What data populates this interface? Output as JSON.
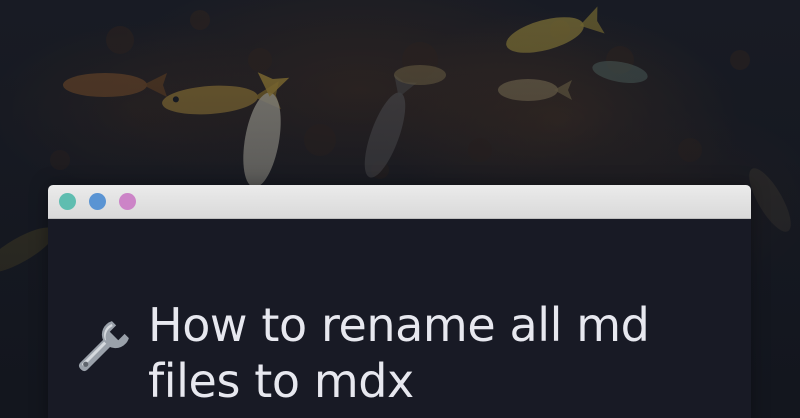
{
  "background": {
    "description_icon": "underwater-fish-reef-photo-icon"
  },
  "window": {
    "controls": [
      {
        "name": "teal",
        "color": "#5fbdb0"
      },
      {
        "name": "blue",
        "color": "#5a94d3"
      },
      {
        "name": "pink",
        "color": "#cc84c7"
      }
    ],
    "emoji_icon": "wrench-icon",
    "title": "How to rename all md files to mdx"
  }
}
